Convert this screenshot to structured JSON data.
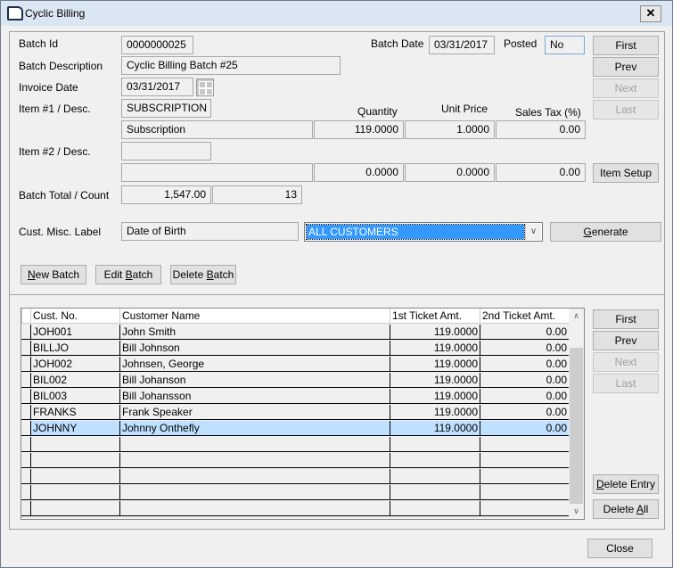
{
  "window": {
    "title": "Cyclic Billing",
    "close_glyph": "✕"
  },
  "header": {
    "batch_id_label": "Batch Id",
    "batch_id": "0000000025",
    "batch_date_label": "Batch Date",
    "batch_date": "03/31/2017",
    "posted_label": "Posted",
    "posted": "No",
    "batch_desc_label": "Batch Description",
    "batch_desc": "Cyclic Billing Batch #25",
    "invoice_date_label": "Invoice Date",
    "invoice_date": "03/31/2017",
    "item1_label": "Item #1 / Desc.",
    "item1_code": "SUBSCRIPTION",
    "item1_desc": "Subscription",
    "item1_qty": "119.0000",
    "item1_price": "1.0000",
    "item1_tax": "0.00",
    "qty_label": "Quantity",
    "price_label": "Unit Price",
    "tax_label": "Sales Tax (%)",
    "item2_label": "Item #2 / Desc.",
    "item2_code": "",
    "item2_desc": "",
    "item2_qty": "0.0000",
    "item2_price": "0.0000",
    "item2_tax": "0.00",
    "total_label": "Batch Total / Count",
    "total": "1,547.00",
    "count": "13",
    "misc_label_label": "Cust. Misc. Label",
    "misc_label": "Date of Birth",
    "customer_filter": "ALL CUSTOMERS"
  },
  "nav_top": {
    "first": "First",
    "prev": "Prev",
    "next": "Next",
    "last": "Last",
    "item_setup": "Item Setup"
  },
  "actions": {
    "generate": "Generate",
    "new_batch": "New Batch",
    "edit_batch": "Edit Batch",
    "delete_batch": "Delete Batch"
  },
  "grid": {
    "columns": [
      "Cust. No.",
      "Customer Name",
      "1st Ticket Amt.",
      "2nd Ticket Amt."
    ],
    "rows": [
      [
        "JOH001",
        "John Smith",
        "119.0000",
        "0.00"
      ],
      [
        "BILLJO",
        "Bill Johnson",
        "119.0000",
        "0.00"
      ],
      [
        "JOH002",
        "Johnsen, George",
        "119.0000",
        "0.00"
      ],
      [
        "BIL002",
        "Bill Johanson",
        "119.0000",
        "0.00"
      ],
      [
        "BIL003",
        "Bill Johansson",
        "119.0000",
        "0.00"
      ],
      [
        "FRANKS",
        "Frank Speaker",
        "119.0000",
        "0.00"
      ],
      [
        "JOHNNY",
        "Johnny Onthefly",
        "119.0000",
        "0.00"
      ]
    ],
    "selected_index": 6
  },
  "nav_bottom": {
    "first": "First",
    "prev": "Prev",
    "next": "Next",
    "last": "Last",
    "delete_entry": "Delete Entry",
    "delete_all": "Delete All"
  },
  "footer": {
    "close": "Close"
  },
  "colors": {
    "selection": "#3399ff",
    "row_selected": "#bfe0ff",
    "posted_border": "#7aa7d8"
  }
}
